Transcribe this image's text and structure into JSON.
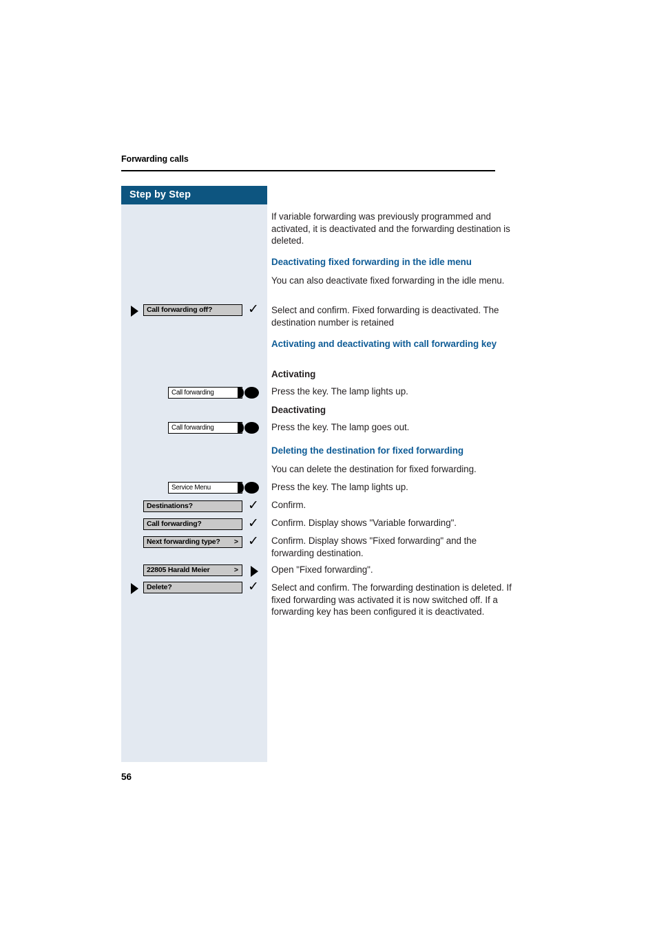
{
  "document": {
    "running_header": "Forwarding calls",
    "page_number": "56"
  },
  "sidebar": {
    "title": "Step by Step",
    "background_color": "#E3E9F1",
    "header_color": "#0D5580"
  },
  "colors": {
    "heading_blue": "#0F5C96",
    "body_text": "#231F20",
    "display_box_fill": "#C9C9C9"
  },
  "glyphs": {
    "check": "✓",
    "chevron": ">"
  },
  "steps": [
    {
      "id": "call-forwarding-off",
      "kind": "display-softkey",
      "label": "Call forwarding off?",
      "leading_marker": "select-triangle",
      "trailing_marker": "confirm-check",
      "inline_arrow": ""
    },
    {
      "id": "call-forwarding-key-activate",
      "kind": "function-key",
      "label": "Call forwarding",
      "leading_marker": "",
      "trailing_marker": "key",
      "inline_arrow": ""
    },
    {
      "id": "call-forwarding-key-deactivate",
      "kind": "function-key",
      "label": "Call forwarding",
      "leading_marker": "",
      "trailing_marker": "key",
      "inline_arrow": ""
    },
    {
      "id": "service-menu-key",
      "kind": "function-key",
      "label": "Service Menu",
      "leading_marker": "",
      "trailing_marker": "key",
      "inline_arrow": ""
    },
    {
      "id": "destinations",
      "kind": "display-softkey",
      "label": "Destinations?",
      "leading_marker": "",
      "trailing_marker": "confirm-check",
      "inline_arrow": ""
    },
    {
      "id": "call-forwarding",
      "kind": "display-softkey",
      "label": "Call forwarding?",
      "leading_marker": "",
      "trailing_marker": "confirm-check",
      "inline_arrow": ""
    },
    {
      "id": "next-forwarding-type",
      "kind": "display-softkey",
      "label": "Next forwarding type?",
      "leading_marker": "",
      "trailing_marker": "confirm-check",
      "inline_arrow": ">"
    },
    {
      "id": "harald-meier-destination",
      "kind": "display-softkey",
      "label": "22805 Harald Meier",
      "leading_marker": "",
      "trailing_marker": "open-triangle",
      "inline_arrow": ">"
    },
    {
      "id": "delete",
      "kind": "display-softkey",
      "label": "Delete?",
      "leading_marker": "select-triangle",
      "trailing_marker": "confirm-check",
      "inline_arrow": ""
    }
  ],
  "content": {
    "intro_paragraph": "If variable forwarding was previously programmed and activated, it is deactivated and the forwarding destination is deleted.",
    "heading_deactivating_idle": "Deactivating fixed forwarding in the idle menu",
    "para_idle_menu": "You can also deactivate fixed forwarding in the idle menu.",
    "para_select_confirm_fixed": "Select and confirm. Fixed forwarding is deactivated. The destination number is retained",
    "heading_activating_deactivating_key": "Activating and deactivating with call forwarding key",
    "subheading_activating": "Activating",
    "para_press_key_lights_up": "Press the key. The lamp lights up.",
    "subheading_deactivating": "Deactivating",
    "para_press_key_goes_out": "Press the key. The lamp goes out.",
    "heading_deleting_destination": "Deleting the destination for fixed forwarding",
    "para_you_can_delete": "You can delete the destination for fixed forwarding.",
    "para_press_key_lights_up_2": "Press the key. The lamp lights up.",
    "para_confirm": "Confirm.",
    "para_confirm_variable": "Confirm. Display shows \"Variable forwarding\".",
    "para_confirm_fixed": "Confirm. Display shows \"Fixed forwarding\" and the forwarding destination.",
    "para_open_fixed": "Open \"Fixed forwarding\".",
    "para_final": "Select and confirm. The forwarding destination is deleted. If fixed forwarding was activated it is now switched off. If a forwarding key has been configured it is deactivated."
  }
}
